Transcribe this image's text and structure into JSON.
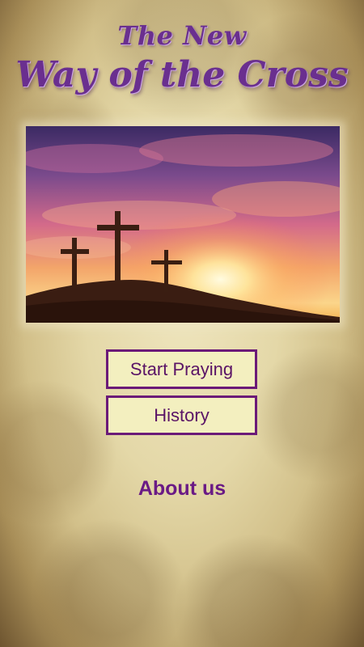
{
  "app": {
    "title_line1": "The New",
    "title_line2": "Way of the Cross"
  },
  "hero_image": {
    "description_icon": "three-crosses-sunset-image"
  },
  "menu": {
    "start_label": "Start Praying",
    "history_label": "History",
    "about_label": "About us"
  },
  "colors": {
    "accent": "#6a2f8f",
    "button_border": "#6b1a78",
    "button_fill": "#f3efbf",
    "parchment": "#e4d8a8"
  }
}
